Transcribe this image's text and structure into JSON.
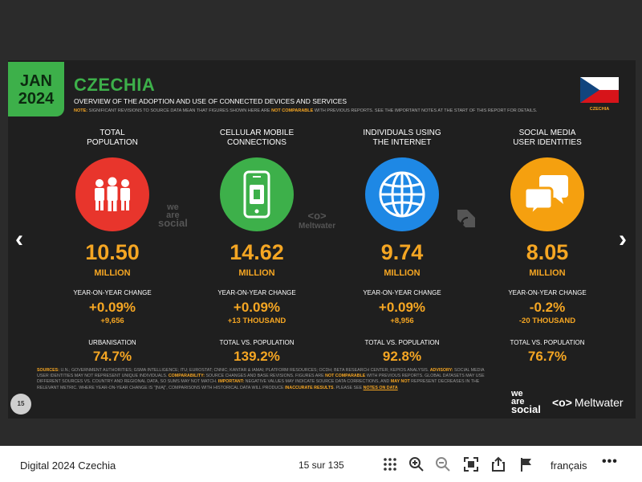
{
  "slide": {
    "date_month": "JAN",
    "date_year": "2024",
    "title": "CZECHIA",
    "subtitle": "OVERVIEW OF THE ADOPTION AND USE OF CONNECTED DEVICES AND SERVICES",
    "note_label": "NOTE:",
    "note_text_1": "SIGNIFICANT REVISIONS TO SOURCE DATA MEAN THAT FIGURES SHOWN HERE ARE",
    "note_highlight": "NOT COMPARABLE",
    "note_text_2": "WITH PREVIOUS REPORTS. SEE THE IMPORTANT NOTES AT THE START OF THIS REPORT FOR DETAILS.",
    "flag_label": "CZECHIA",
    "flag_colors": {
      "white": "#ffffff",
      "red": "#d7141a",
      "blue": "#11457e"
    },
    "page_number": "15",
    "logo_we": "we",
    "logo_are": "are",
    "logo_social": "social",
    "logo_meltwater": "Meltwater",
    "logo_meltwater_mark": "<o>",
    "columns": [
      {
        "heading_1": "TOTAL",
        "heading_2": "POPULATION",
        "icon": "people-icon",
        "color": "#e8352c",
        "value": "10.50",
        "unit": "MILLION",
        "change_label": "YEAR-ON-YEAR CHANGE",
        "change_pct": "+0.09%",
        "change_abs": "+9,656",
        "stat_label": "URBANISATION",
        "stat_value": "74.7%"
      },
      {
        "heading_1": "CELLULAR MOBILE",
        "heading_2": "CONNECTIONS",
        "icon": "mobile-phone-icon",
        "color": "#3db04a",
        "value": "14.62",
        "unit": "MILLION",
        "change_label": "YEAR-ON-YEAR CHANGE",
        "change_pct": "+0.09%",
        "change_abs": "+13 THOUSAND",
        "stat_label": "TOTAL vs. POPULATION",
        "stat_value": "139.2%"
      },
      {
        "heading_1": "INDIVIDUALS USING",
        "heading_2": "THE INTERNET",
        "icon": "globe-icon",
        "color": "#1e88e5",
        "value": "9.74",
        "unit": "MILLION",
        "change_label": "YEAR-ON-YEAR CHANGE",
        "change_pct": "+0.09%",
        "change_abs": "+8,956",
        "stat_label": "TOTAL vs. POPULATION",
        "stat_value": "92.8%"
      },
      {
        "heading_1": "SOCIAL MEDIA",
        "heading_2": "USER IDENTITIES",
        "icon": "speech-bubbles-icon",
        "color": "#f5a00f",
        "value": "8.05",
        "unit": "MILLION",
        "change_label": "YEAR-ON-YEAR CHANGE",
        "change_pct": "-0.2%",
        "change_abs": "-20 THOUSAND",
        "stat_label": "TOTAL vs. POPULATION",
        "stat_value": "76.7%"
      }
    ],
    "sources": {
      "label": "SOURCES:",
      "text_1": "U.N.; GOVERNMENT AUTHORITIES; GSMA INTELLIGENCE; ITU; EUROSTAT; CNNIC; KANTAR & IAMAI; PLATFORM RESOURCES; OCDH; BETA RESEARCH CENTER; KEPIOS ANALYSIS.",
      "advisory_label": "ADVISORY:",
      "text_2": "SOCIAL MEDIA USER IDENTITIES MAY NOT REPRESENT UNIQUE INDIVIDUALS.",
      "comparability_label": "COMPARABILITY:",
      "text_3": "SOURCE CHANGES AND BASE REVISIONS. FIGURES ARE",
      "not_comparable": "NOT COMPARABLE",
      "text_4": "WITH PREVIOUS REPORTS. GLOBAL DATASETS MAY USE DIFFERENT SOURCES vs. COUNTRY AND REGIONAL DATA, SO SUMS MAY NOT MATCH.",
      "important_label": "IMPORTANT:",
      "text_5": "NEGATIVE VALUES MAY INDICATE SOURCE DATA CORRECTIONS, AND",
      "may_not": "MAY NOT",
      "text_6": "REPRESENT DECREASES IN THE RELEVANT METRIC. WHERE YEAR-ON-YEAR CHANGE IS \"[N/A]\", COMPARISONS WITH HISTORICAL DATA WILL PRODUCE",
      "inaccurate": "INACCURATE RESULTS",
      "text_7": ". PLEASE SEE",
      "notes_on_data": "NOTES ON DATA"
    },
    "watermarks": {
      "was_1": "we",
      "was_2": "are",
      "was_3": "social",
      "meltwater": "Meltwater"
    }
  },
  "toolbar": {
    "doc_title": "Digital 2024 Czechia",
    "page_count": "15 sur 135",
    "language": "français",
    "more": "•••"
  },
  "nav": {
    "prev": "‹",
    "next": "›"
  }
}
